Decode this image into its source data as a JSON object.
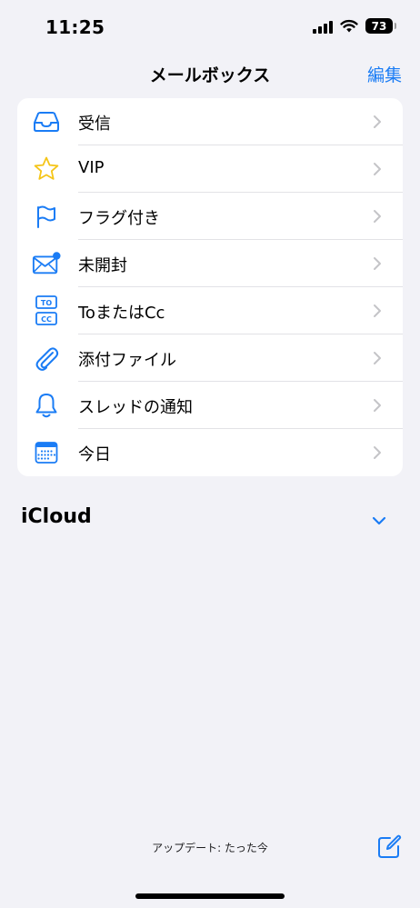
{
  "status_bar": {
    "time": "11:25",
    "battery": "73"
  },
  "nav": {
    "title": "メールボックス",
    "edit_label": "編集"
  },
  "mailboxes": [
    {
      "label": "受信",
      "icon": "inbox-icon"
    },
    {
      "label": "VIP",
      "icon": "star-icon"
    },
    {
      "label": "フラグ付き",
      "icon": "flag-icon"
    },
    {
      "label": "未開封",
      "icon": "unread-envelope-icon"
    },
    {
      "label": "ToまたはCc",
      "icon": "to-cc-icon"
    },
    {
      "label": "添付ファイル",
      "icon": "paperclip-icon"
    },
    {
      "label": "スレッドの通知",
      "icon": "bell-icon"
    },
    {
      "label": "今日",
      "icon": "calendar-icon"
    }
  ],
  "accounts": {
    "icloud_label": "iCloud"
  },
  "toolbar": {
    "update_status": "アップデート: たった今"
  },
  "colors": {
    "accent": "#1a7cf5",
    "vip_star": "#f5c518",
    "background": "#f2f2f7",
    "card": "#ffffff",
    "chevron": "#c4c4c7"
  }
}
